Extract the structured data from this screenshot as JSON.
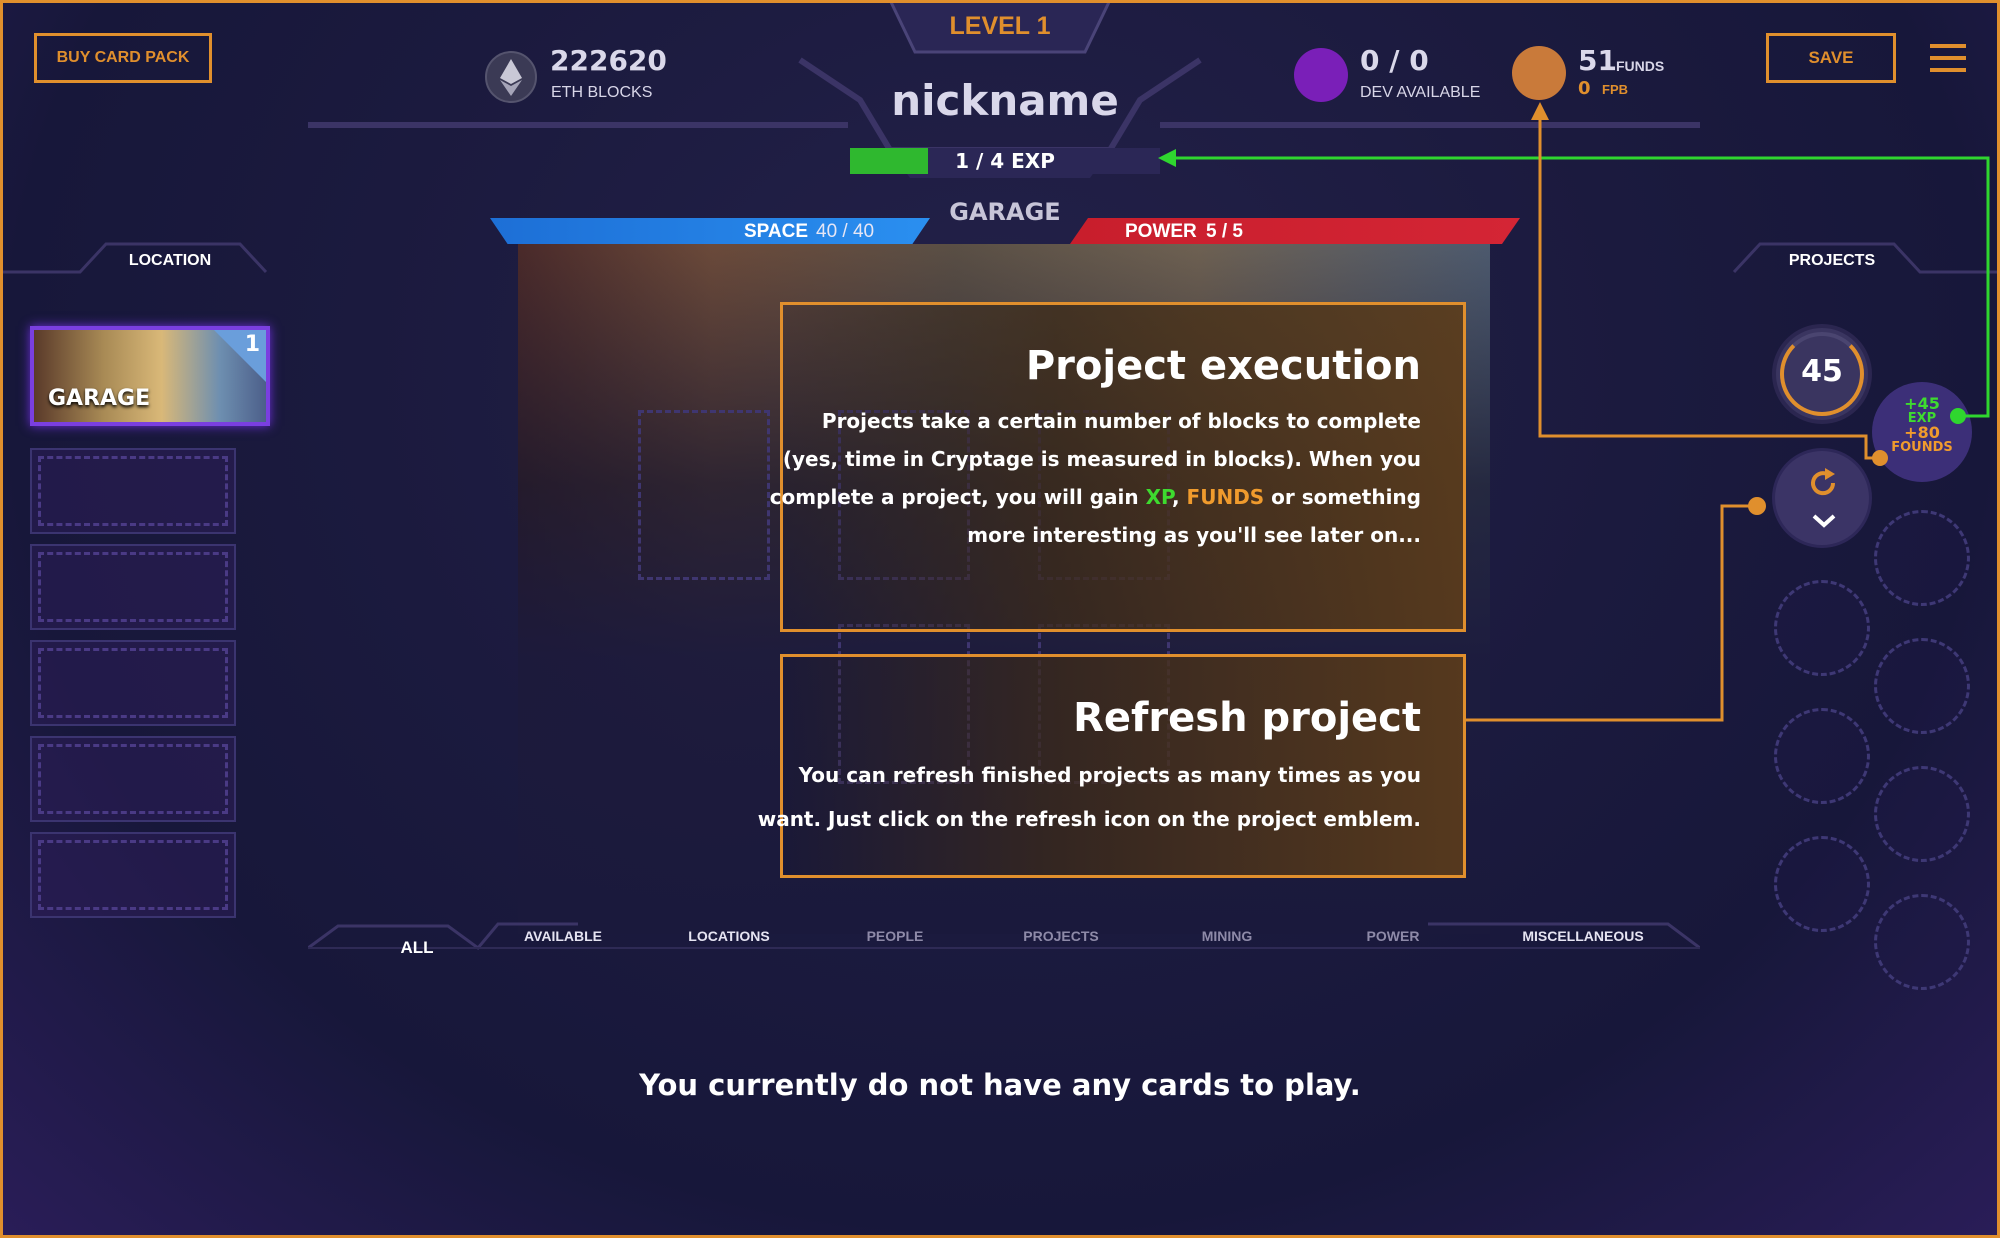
{
  "header": {
    "buy_card_pack": "BUY CARD PACK",
    "eth_blocks_value": "222620",
    "eth_blocks_label": "ETH BLOCKS",
    "level": "LEVEL 1",
    "nickname": "nickname",
    "exp_text": "1 / 4 EXP",
    "exp_progress": 0.25,
    "dev_value": "0 / 0",
    "dev_label": "DEV AVAILABLE",
    "funds_value": "51",
    "funds_label": "FUNDS",
    "fpb_value": "0",
    "fpb_label": "FPB",
    "save": "SAVE",
    "menu_icon": "hamburger-menu-icon"
  },
  "garage": {
    "title": "GARAGE",
    "space_label": "SPACE",
    "space_value": "40 / 40",
    "power_label": "POWER",
    "power_value": "5 / 5"
  },
  "left_sidebar": {
    "heading": "LOCATION",
    "active_card": {
      "label": "GARAGE",
      "count": "1"
    },
    "empty_slots": 5
  },
  "right_sidebar": {
    "heading": "PROJECTS",
    "project_emblem_value": "45",
    "reward_exp": "+45",
    "reward_exp_label": "EXP",
    "reward_funds": "+80",
    "reward_funds_label": "FOUNDS"
  },
  "tutorial": {
    "execution_title": "Project execution",
    "execution_line1": "Projects take a certain number of blocks to complete",
    "execution_line2": "(yes, time in Cryptage is measured in blocks). When you",
    "execution_line3_a": "complete a project, you will gain ",
    "execution_line3_xp": "XP",
    "execution_line3_comma": ", ",
    "execution_line3_funds": "FUNDS",
    "execution_line3_b": " or something",
    "execution_line4": "more interesting as you'll see later on...",
    "refresh_title": "Refresh project",
    "refresh_line1": "You can refresh finished projects as many times as you",
    "refresh_line2": "want. Just click on the refresh icon on the project emblem."
  },
  "tabs": [
    "ALL",
    "AVAILABLE",
    "LOCATIONS",
    "PEOPLE",
    "PROJECTS",
    "MINING",
    "POWER",
    "MISCELLANEOUS"
  ],
  "empty_message": "You currently do not have any cards to play.",
  "colors": {
    "accent_orange": "#e08f2d",
    "exp_green": "#2fb82f",
    "space_blue": "#1d6fd6",
    "power_red": "#c81e2c",
    "background": "#1b1a3e"
  }
}
